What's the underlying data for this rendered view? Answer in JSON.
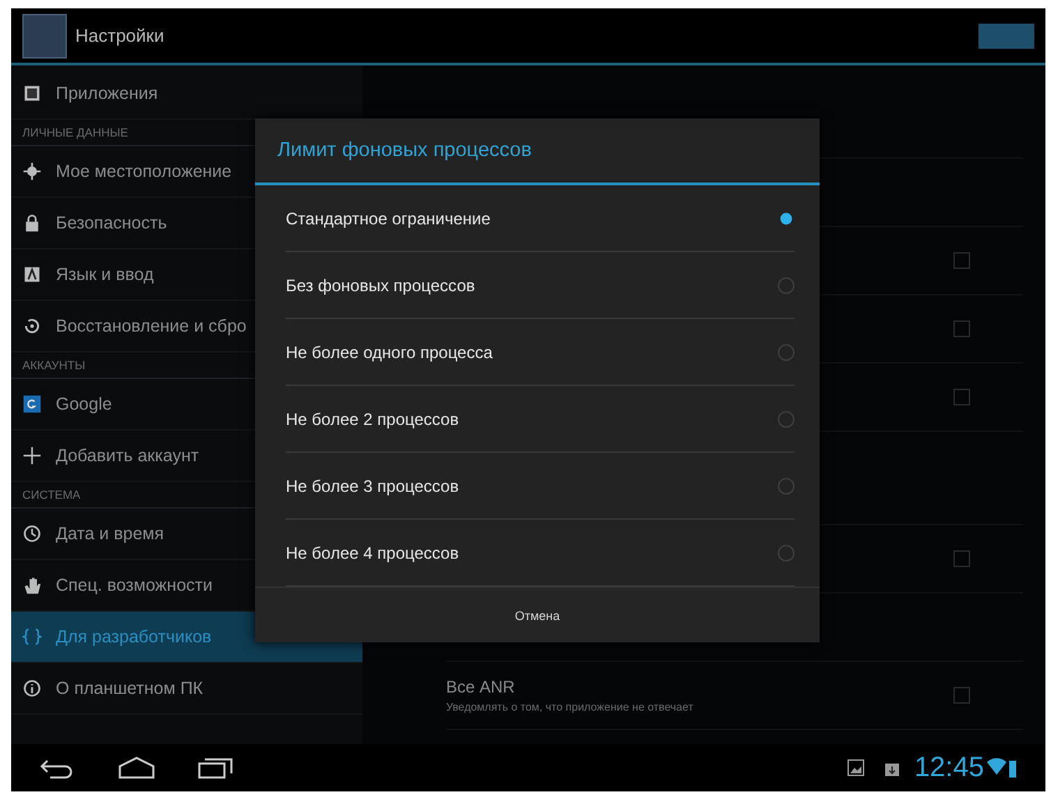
{
  "action_bar": {
    "title": "Настройки",
    "master_switch": {
      "on": true
    }
  },
  "sidebar": {
    "items": [
      {
        "kind": "item",
        "label": "Приложения",
        "selected": false
      },
      {
        "kind": "header",
        "label": "ЛИЧНЫЕ ДАННЫЕ"
      },
      {
        "kind": "item",
        "label": "Мое местоположение",
        "selected": false
      },
      {
        "kind": "item",
        "label": "Безопасность",
        "selected": false
      },
      {
        "kind": "item",
        "label": "Язык и ввод",
        "selected": false
      },
      {
        "kind": "item",
        "label": "Восстановление и сбро",
        "selected": false
      },
      {
        "kind": "header",
        "label": "АККАУНТЫ"
      },
      {
        "kind": "item",
        "label": "Google",
        "selected": false
      },
      {
        "kind": "item",
        "label": "Добавить аккаунт",
        "selected": false
      },
      {
        "kind": "header",
        "label": "СИСТЕМА"
      },
      {
        "kind": "item",
        "label": "Дата и время",
        "selected": false
      },
      {
        "kind": "item",
        "label": "Спец. возможности",
        "selected": false
      },
      {
        "kind": "item",
        "label": "Для разработчиков",
        "selected": true
      },
      {
        "kind": "item",
        "label": "О планшетном ПК",
        "selected": false
      }
    ]
  },
  "detail_rows": [
    {
      "kind": "blank"
    },
    {
      "kind": "blank"
    },
    {
      "kind": "checkbox",
      "checked": false
    },
    {
      "kind": "checkbox",
      "checked": false
    },
    {
      "kind": "checkbox",
      "checked": false
    },
    {
      "kind": "gap"
    },
    {
      "kind": "checkbox",
      "checked": false
    },
    {
      "kind": "blank"
    },
    {
      "kind": "checkbox",
      "checked": false,
      "title": "Все ANR",
      "subtitle": "Уведомлять о том, что приложение не отвечает"
    }
  ],
  "dialog": {
    "title": "Лимит фоновых процессов",
    "options": [
      {
        "label": "Стандартное ограничение",
        "selected": true
      },
      {
        "label": "Без фоновых процессов",
        "selected": false
      },
      {
        "label": "Не более одного процесса",
        "selected": false
      },
      {
        "label": "Не более 2 процессов",
        "selected": false
      },
      {
        "label": "Не более 3 процессов",
        "selected": false
      },
      {
        "label": "Не более 4 процессов",
        "selected": false
      }
    ],
    "cancel": "Отмена"
  },
  "system_bar": {
    "time": "12:45"
  }
}
